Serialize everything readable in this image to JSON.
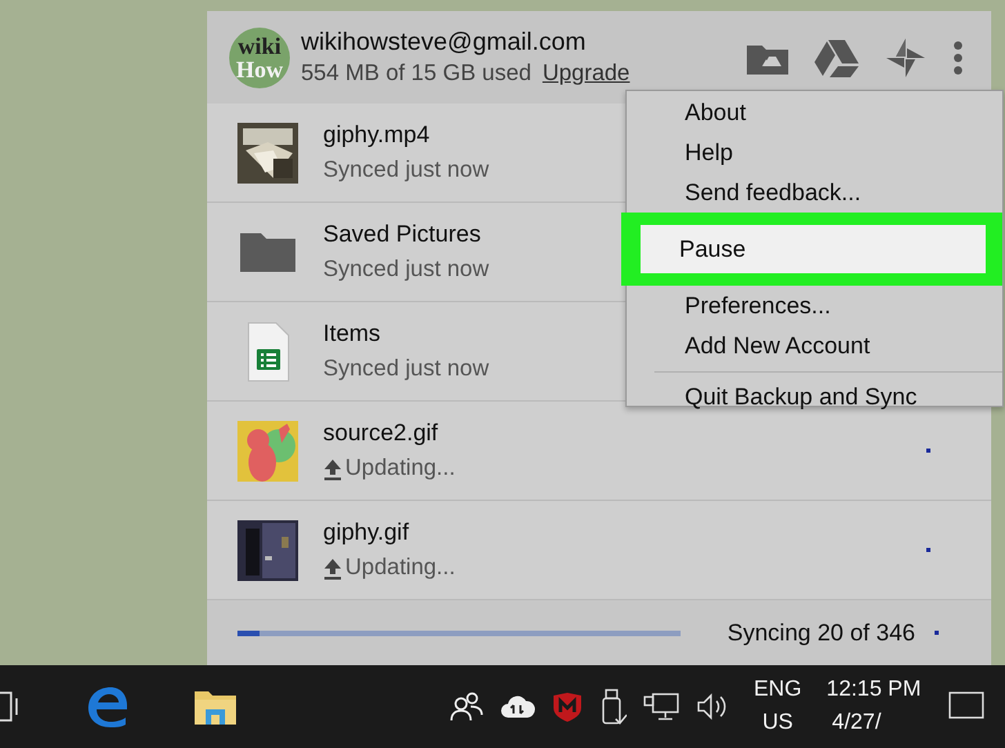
{
  "account": {
    "avatar_lines": [
      "wiki",
      "How"
    ],
    "email": "wikihowsteve@gmail.com",
    "usage": "554 MB of 15 GB used",
    "upgrade_link": "Upgrade"
  },
  "files": [
    {
      "name": "giphy.mp4",
      "status": "Synced just now",
      "kind": "picture",
      "uploading": false
    },
    {
      "name": "Saved Pictures",
      "status": "Synced just now",
      "kind": "folder",
      "uploading": false
    },
    {
      "name": "Items",
      "status": "Synced just now",
      "kind": "sheet",
      "uploading": false
    },
    {
      "name": "source2.gif",
      "status": "Updating...",
      "kind": "cartoon",
      "uploading": true
    },
    {
      "name": "giphy.gif",
      "status": "Updating...",
      "kind": "dark",
      "uploading": true
    }
  ],
  "footer": {
    "status": "Syncing 20 of 346",
    "level": 0.05
  },
  "menu": [
    {
      "label": "About",
      "selected": false,
      "divider_above": false
    },
    {
      "label": "Help",
      "selected": false,
      "divider_above": false
    },
    {
      "label": "Send feedback...",
      "selected": false,
      "divider_above": false
    },
    {
      "label": "Pause",
      "selected": true,
      "divider_above": false
    },
    {
      "label": "Preferences...",
      "selected": false,
      "divider_above": false
    },
    {
      "label": "Add New Account",
      "selected": false,
      "divider_above": false
    },
    {
      "label": "Quit Backup and Sync",
      "selected": false,
      "divider_above": true
    }
  ],
  "taskbar": {
    "language": [
      "ENG",
      "US"
    ],
    "time": "12:15 PM",
    "date": "4/27/"
  }
}
